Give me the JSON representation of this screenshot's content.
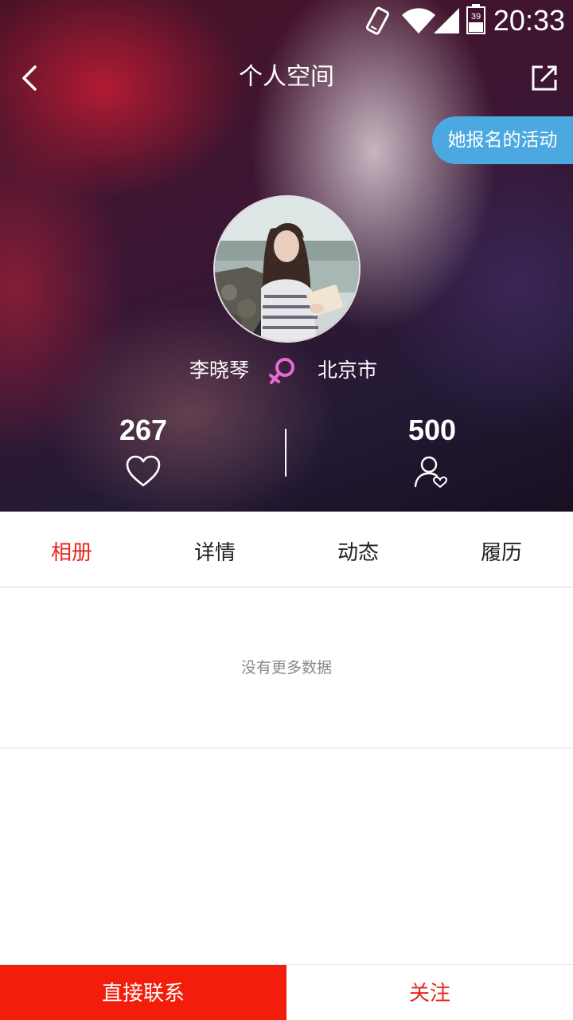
{
  "status_bar": {
    "time": "20:33",
    "battery_level": "39",
    "icons": [
      "rotate-phone-icon",
      "wifi-icon",
      "signal-icon",
      "battery-icon"
    ]
  },
  "header": {
    "title": "个人空间",
    "back_icon": "chevron-left-icon",
    "share_icon": "share-icon",
    "activities_button": "她报名的活动"
  },
  "profile": {
    "name": "李晓琴",
    "gender_icon": "female-icon",
    "city": "北京市",
    "likes_count": "267",
    "likes_icon": "heart-icon",
    "followers_count": "500",
    "followers_icon": "user-heart-icon"
  },
  "tabs": [
    {
      "label": "相册",
      "active": true
    },
    {
      "label": "详情",
      "active": false
    },
    {
      "label": "动态",
      "active": false
    },
    {
      "label": "履历",
      "active": false
    }
  ],
  "content": {
    "empty_message": "没有更多数据"
  },
  "bottom_bar": {
    "contact_label": "直接联系",
    "follow_label": "关注"
  },
  "colors": {
    "accent_red": "#e8261f",
    "contact_button_bg": "#f21d0b",
    "activities_button_bg": "#4ba8e0",
    "female_icon": "#e86ad2"
  }
}
